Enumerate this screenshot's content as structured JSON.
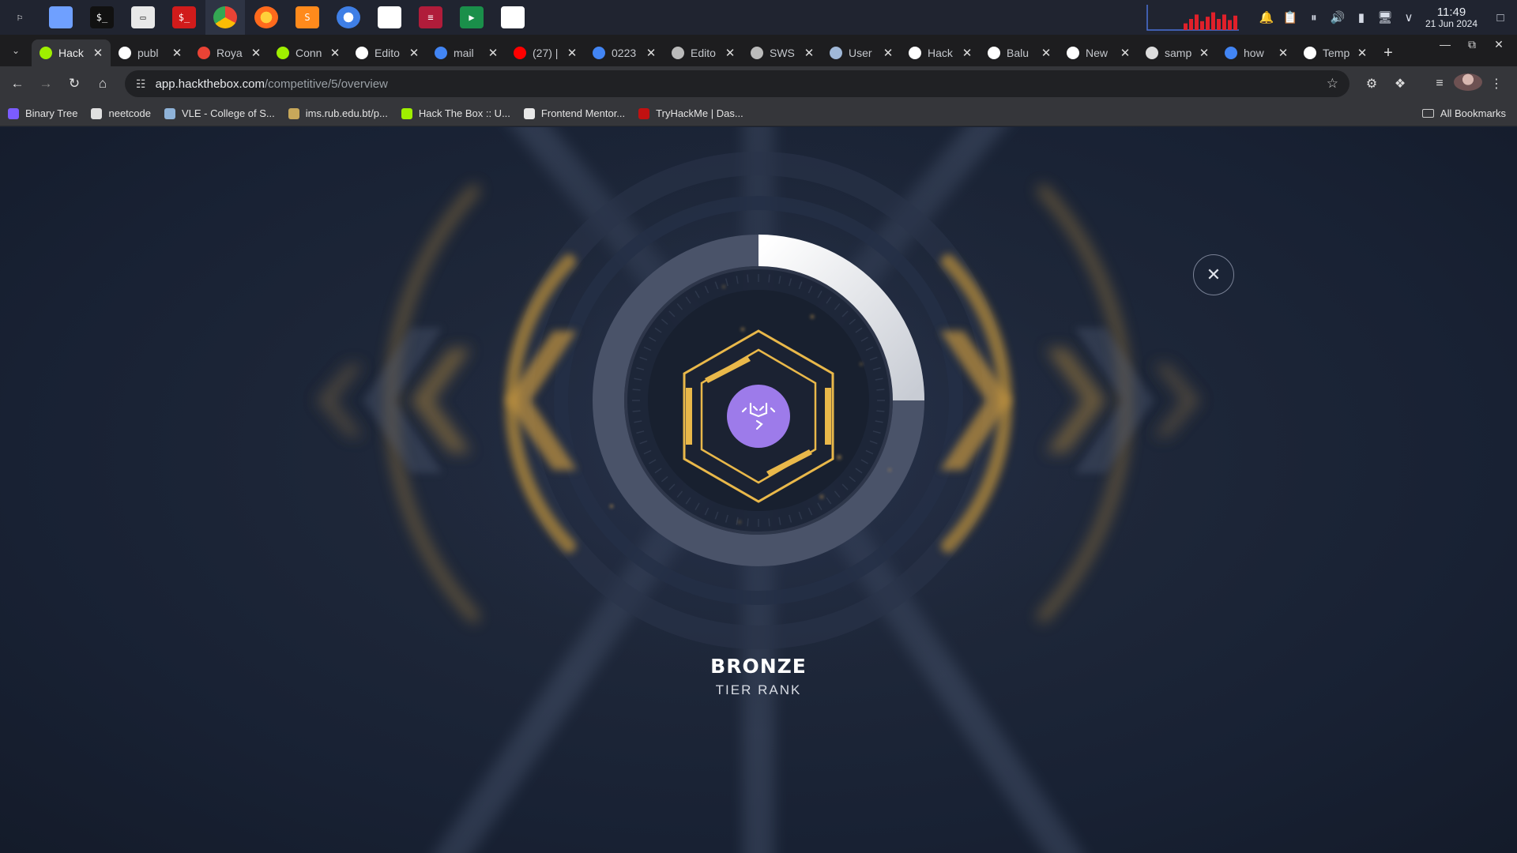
{
  "taskbar": {
    "apps": [
      {
        "icon": "app-launcher-icon",
        "active": false
      },
      {
        "icon": "desktop-workspace-icon",
        "active": false
      },
      {
        "icon": "terminal-icon",
        "active": false
      },
      {
        "icon": "file-manager-icon",
        "active": false
      },
      {
        "icon": "red-terminal-icon",
        "active": false
      },
      {
        "icon": "chrome-icon",
        "active": true
      },
      {
        "icon": "firefox-icon",
        "active": false
      },
      {
        "icon": "sublime-text-icon",
        "active": false
      },
      {
        "icon": "chromium-icon",
        "active": false
      },
      {
        "icon": "text-editor-icon",
        "active": false
      },
      {
        "icon": "document-viewer-icon",
        "active": false
      },
      {
        "icon": "media-player-icon",
        "active": false
      },
      {
        "icon": "text-editor-icon",
        "active": false
      }
    ],
    "clock_time": "11:49",
    "clock_date": "21 Jun 2024"
  },
  "tabs": [
    {
      "title": "Hack",
      "icon": "htb-icon",
      "color": "#9fef00",
      "active": true
    },
    {
      "title": "publ",
      "icon": "github-icon",
      "color": "#ffffff",
      "active": false
    },
    {
      "title": "Roya",
      "icon": "gmail-icon",
      "color": "#ea4335",
      "active": false
    },
    {
      "title": "Conn",
      "icon": "htb-icon",
      "color": "#9fef00",
      "active": false
    },
    {
      "title": "Edito",
      "icon": "medium-icon",
      "color": "#ffffff",
      "active": false
    },
    {
      "title": "mail",
      "icon": "google-icon",
      "color": "#4285f4",
      "active": false
    },
    {
      "title": "(27) |",
      "icon": "youtube-icon",
      "color": "#ff0000",
      "active": false
    },
    {
      "title": "0223",
      "icon": "docs-icon",
      "color": "#4285f4",
      "active": false
    },
    {
      "title": "Edito",
      "icon": "globe-icon",
      "color": "#bbbbbb",
      "active": false
    },
    {
      "title": "SWS",
      "icon": "globe-icon",
      "color": "#bbbbbb",
      "active": false
    },
    {
      "title": "User",
      "icon": "page-icon",
      "color": "#a0b8d8",
      "active": false
    },
    {
      "title": "Hack",
      "icon": "medium-icon",
      "color": "#ffffff",
      "active": false
    },
    {
      "title": "Balu",
      "icon": "github-icon",
      "color": "#ffffff",
      "active": false
    },
    {
      "title": "New",
      "icon": "chatgpt-icon",
      "color": "#ffffff",
      "active": false
    },
    {
      "title": "samp",
      "icon": "code-icon",
      "color": "#dddddd",
      "active": false
    },
    {
      "title": "how",
      "icon": "google-icon",
      "color": "#4285f4",
      "active": false
    },
    {
      "title": "Temp",
      "icon": "medium-icon",
      "color": "#ffffff",
      "active": false
    }
  ],
  "address": {
    "domain": "app.hackthebox.com",
    "path": "/competitive/5/overview"
  },
  "bookmarks": [
    {
      "label": "Binary Tree",
      "color": "#7b5cff"
    },
    {
      "label": "neetcode",
      "color": "#e0e0e0"
    },
    {
      "label": "VLE - College of S...",
      "color": "#8fb3d9"
    },
    {
      "label": "ims.rub.edu.bt/p...",
      "color": "#c8a85a"
    },
    {
      "label": "Hack The Box :: U...",
      "color": "#9fef00"
    },
    {
      "label": "Frontend Mentor...",
      "color": "#e8e8e8"
    },
    {
      "label": "TryHackMe | Das...",
      "color": "#c11111"
    }
  ],
  "bookmarks_all": "All Bookmarks",
  "rank": {
    "tier_name": "BRONZE",
    "tier_label": "TIER RANK",
    "progress_fraction": 0.25,
    "accent_color": "#e9b84a",
    "badge_color": "#9d7bea"
  }
}
